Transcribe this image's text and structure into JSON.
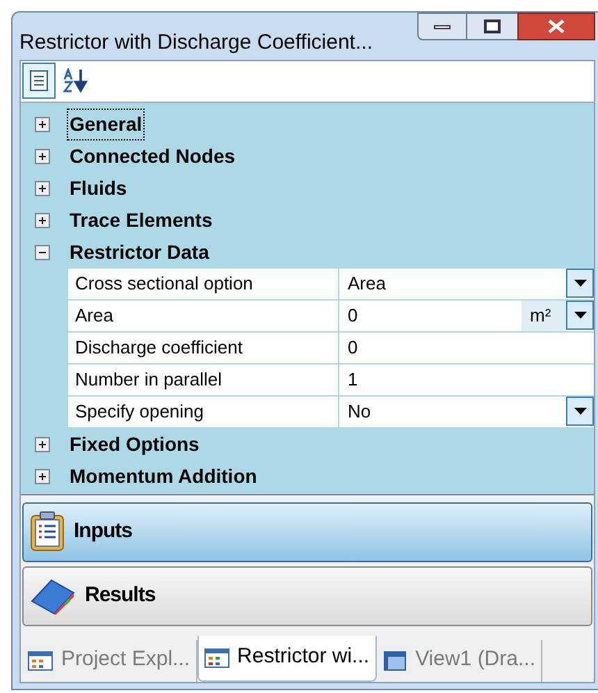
{
  "window": {
    "title": "Restrictor with Discharge Coefficient..."
  },
  "toolbar": [
    {
      "kind": "categorized",
      "selected": true
    },
    {
      "kind": "alphabetical",
      "selected": false
    }
  ],
  "categories": [
    {
      "name": "General",
      "expanded": false,
      "focused": true
    },
    {
      "name": "Connected Nodes",
      "expanded": false,
      "focused": false
    },
    {
      "name": "Fluids",
      "expanded": false,
      "focused": false
    },
    {
      "name": "Trace Elements",
      "expanded": false,
      "focused": false
    },
    {
      "name": "Restrictor Data",
      "expanded": true,
      "focused": false,
      "properties": [
        {
          "name": "Cross sectional option",
          "value": "Area",
          "dropdown": true
        },
        {
          "name": "Area",
          "value": "0",
          "unit": "m²",
          "dropdown": true
        },
        {
          "name": "Discharge coefficient",
          "value": "0",
          "dropdown": false
        },
        {
          "name": "Number in parallel",
          "value": "1",
          "dropdown": false
        },
        {
          "name": "Specify opening",
          "value": "No",
          "dropdown": true
        }
      ]
    },
    {
      "name": "Fixed Options",
      "expanded": false,
      "focused": false
    },
    {
      "name": "Momentum Addition",
      "expanded": false,
      "focused": false
    }
  ],
  "panels": [
    {
      "kind": "inputs",
      "label": "Inputs",
      "selected": true
    },
    {
      "kind": "results",
      "label": "Results",
      "selected": false
    }
  ],
  "tabs": [
    {
      "kind": "explorer",
      "label": "Project Expl...",
      "selected": false
    },
    {
      "kind": "form",
      "label": "Restrictor wi...",
      "selected": true
    },
    {
      "kind": "view",
      "label": "View1 (Dra...",
      "selected": false
    }
  ]
}
